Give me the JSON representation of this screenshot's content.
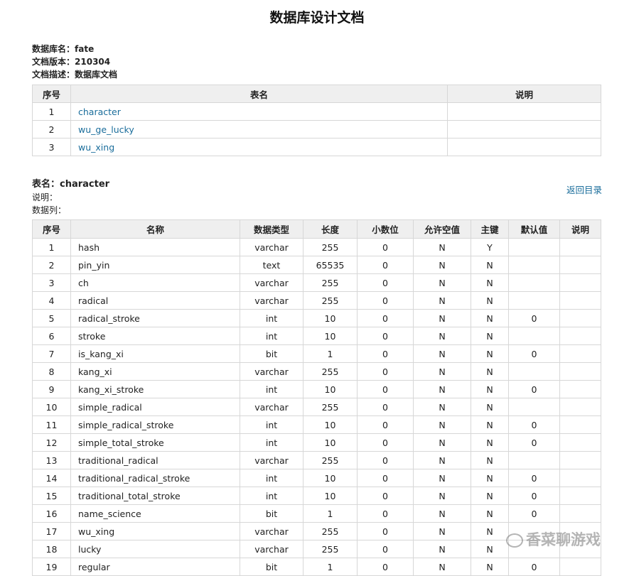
{
  "page": {
    "title": "数据库设计文档"
  },
  "meta": {
    "db_label": "数据库名：",
    "db_value": "fate",
    "ver_label": "文档版本：",
    "ver_value": "210304",
    "desc_label": "文档描述：",
    "desc_value": "数据库文档"
  },
  "toc": {
    "headers": [
      "序号",
      "表名",
      "说明"
    ],
    "rows": [
      {
        "idx": "1",
        "name": "character",
        "desc": ""
      },
      {
        "idx": "2",
        "name": "wu_ge_lucky",
        "desc": ""
      },
      {
        "idx": "3",
        "name": "wu_xing",
        "desc": ""
      }
    ]
  },
  "section": {
    "table_label": "表名：",
    "table_name": "character",
    "desc_label": "说明：",
    "desc_value": "",
    "cols_label": "数据列：",
    "back_link": "返回目录"
  },
  "columns": {
    "headers": [
      "序号",
      "名称",
      "数据类型",
      "长度",
      "小数位",
      "允许空值",
      "主键",
      "默认值",
      "说明"
    ],
    "rows": [
      [
        "1",
        "hash",
        "varchar",
        "255",
        "0",
        "N",
        "Y",
        "",
        ""
      ],
      [
        "2",
        "pin_yin",
        "text",
        "65535",
        "0",
        "N",
        "N",
        "",
        ""
      ],
      [
        "3",
        "ch",
        "varchar",
        "255",
        "0",
        "N",
        "N",
        "",
        ""
      ],
      [
        "4",
        "radical",
        "varchar",
        "255",
        "0",
        "N",
        "N",
        "",
        ""
      ],
      [
        "5",
        "radical_stroke",
        "int",
        "10",
        "0",
        "N",
        "N",
        "0",
        ""
      ],
      [
        "6",
        "stroke",
        "int",
        "10",
        "0",
        "N",
        "N",
        "",
        ""
      ],
      [
        "7",
        "is_kang_xi",
        "bit",
        "1",
        "0",
        "N",
        "N",
        "0",
        ""
      ],
      [
        "8",
        "kang_xi",
        "varchar",
        "255",
        "0",
        "N",
        "N",
        "",
        ""
      ],
      [
        "9",
        "kang_xi_stroke",
        "int",
        "10",
        "0",
        "N",
        "N",
        "0",
        ""
      ],
      [
        "10",
        "simple_radical",
        "varchar",
        "255",
        "0",
        "N",
        "N",
        "",
        ""
      ],
      [
        "11",
        "simple_radical_stroke",
        "int",
        "10",
        "0",
        "N",
        "N",
        "0",
        ""
      ],
      [
        "12",
        "simple_total_stroke",
        "int",
        "10",
        "0",
        "N",
        "N",
        "0",
        ""
      ],
      [
        "13",
        "traditional_radical",
        "varchar",
        "255",
        "0",
        "N",
        "N",
        "",
        ""
      ],
      [
        "14",
        "traditional_radical_stroke",
        "int",
        "10",
        "0",
        "N",
        "N",
        "0",
        ""
      ],
      [
        "15",
        "traditional_total_stroke",
        "int",
        "10",
        "0",
        "N",
        "N",
        "0",
        ""
      ],
      [
        "16",
        "name_science",
        "bit",
        "1",
        "0",
        "N",
        "N",
        "0",
        ""
      ],
      [
        "17",
        "wu_xing",
        "varchar",
        "255",
        "0",
        "N",
        "N",
        "",
        ""
      ],
      [
        "18",
        "lucky",
        "varchar",
        "255",
        "0",
        "N",
        "N",
        "",
        ""
      ],
      [
        "19",
        "regular",
        "bit",
        "1",
        "0",
        "N",
        "N",
        "0",
        ""
      ]
    ]
  },
  "watermark": {
    "text": "香菜聊游戏"
  },
  "colors": {
    "link": "#1a6d9b",
    "header_bg": "#efefef",
    "border": "#d7d7d7"
  }
}
